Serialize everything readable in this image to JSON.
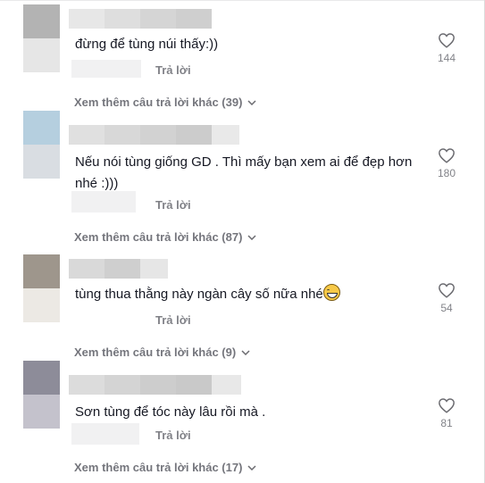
{
  "comments": [
    {
      "text": "đừng để tùng núi thấy:))",
      "reply_label": "Trả lời",
      "like_count": "144",
      "more_replies": "Xem thêm câu trả lời khác (39)",
      "avatar_colors": [
        "#b3b3b3",
        "#e6e6e6"
      ]
    },
    {
      "text": "Nếu nói tùng giống GD . Thì mấy bạn xem ai để đẹp hơn\nnhé :)))",
      "reply_label": "Trả lời",
      "like_count": "180",
      "more_replies": "Xem thêm câu trả lời khác (87)",
      "avatar_colors": [
        "#b5cfdf",
        "#d9dde2"
      ]
    },
    {
      "text": "tùng thua thằng này ngàn cây số nữa nhé",
      "reply_label": "Trả lời",
      "like_count": "54",
      "more_replies": "Xem thêm câu trả lời khác (9)",
      "avatar_colors": [
        "#9e968c",
        "#ece9e4"
      ],
      "emoji": "grinning-sweat-emoji"
    },
    {
      "text": "Sơn tùng để tóc này lâu rồi mà .",
      "reply_label": "Trả lời",
      "like_count": "81",
      "more_replies": "Xem thêm câu trả lời khác (17)",
      "avatar_colors": [
        "#8d8c99",
        "#c4c2cc"
      ]
    }
  ]
}
